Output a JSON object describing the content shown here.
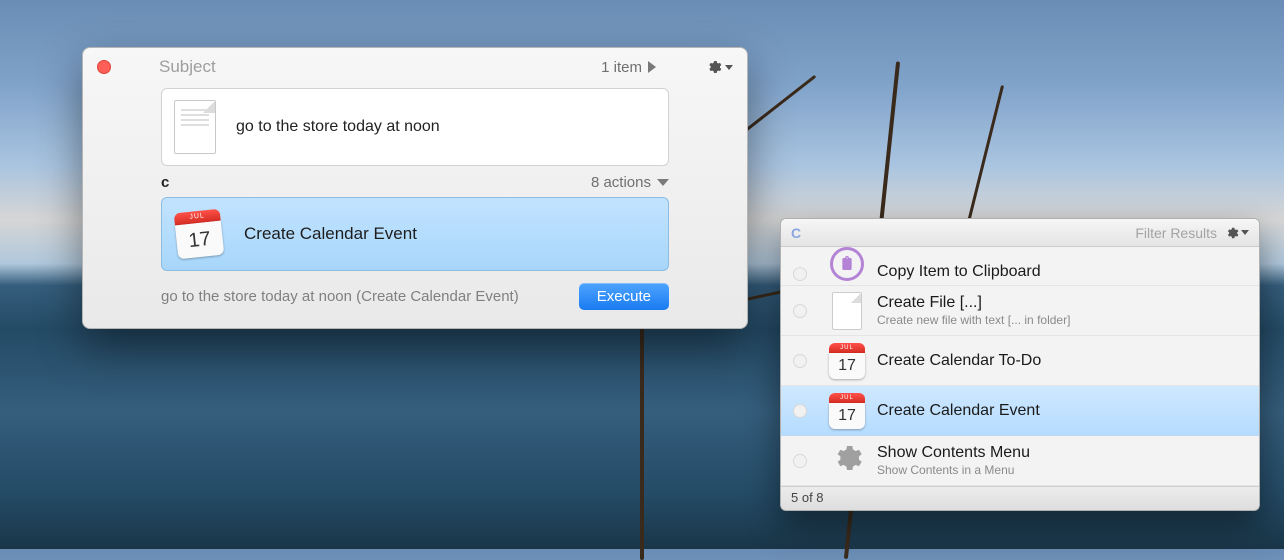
{
  "panel1": {
    "title": "Subject",
    "item_count": "1 item",
    "input_text": "go to the store today at noon",
    "filter_char": "c",
    "actions_count": "8 actions",
    "selected_action": {
      "label": "Create Calendar Event",
      "icon_month": "JUL",
      "icon_day": "17"
    },
    "footer_text": "go to the store today at noon (Create Calendar Event)",
    "execute_label": "Execute"
  },
  "panel2": {
    "filter_char": "C",
    "filter_label": "Filter Results",
    "footer": "5 of 8",
    "cal_icon_month": "JUL",
    "cal_icon_day": "17",
    "items": [
      {
        "title": "Copy Item to Clipboard",
        "subtitle": "",
        "icon": "clipboard",
        "selected": false,
        "partial": true
      },
      {
        "title": "Create File [...]",
        "subtitle": "Create new file with text [... in folder]",
        "icon": "file",
        "selected": false
      },
      {
        "title": "Create Calendar To-Do",
        "subtitle": "",
        "icon": "calendar",
        "selected": false
      },
      {
        "title": "Create Calendar Event",
        "subtitle": "",
        "icon": "calendar",
        "selected": true
      },
      {
        "title": "Show Contents Menu",
        "subtitle": "Show Contents in a Menu",
        "icon": "gear",
        "selected": false
      }
    ]
  }
}
